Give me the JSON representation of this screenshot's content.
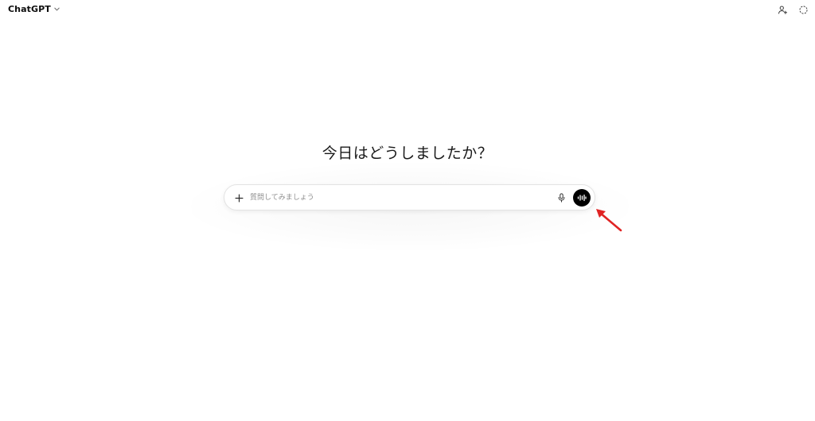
{
  "header": {
    "model_name": "ChatGPT",
    "model_dropdown_icon": "chevron-down-icon",
    "right_icons": [
      "add-user-icon",
      "temporary-chat-icon"
    ]
  },
  "main": {
    "greeting": "今日はどうしましたか？"
  },
  "composer": {
    "placeholder": "質問してみましょう",
    "value": "",
    "attach_icon": "plus-icon",
    "dictate_icon": "microphone-icon",
    "voice_icon": "voice-waveform-icon"
  },
  "annotation": {
    "type": "arrow",
    "icon": "red-arrow-icon",
    "color": "#e02424"
  },
  "colors": {
    "background": "#ffffff",
    "text": "#0d0d0d",
    "placeholder": "#8f8f8f",
    "voice_button": "#000000",
    "annotation_red": "#e02424"
  }
}
